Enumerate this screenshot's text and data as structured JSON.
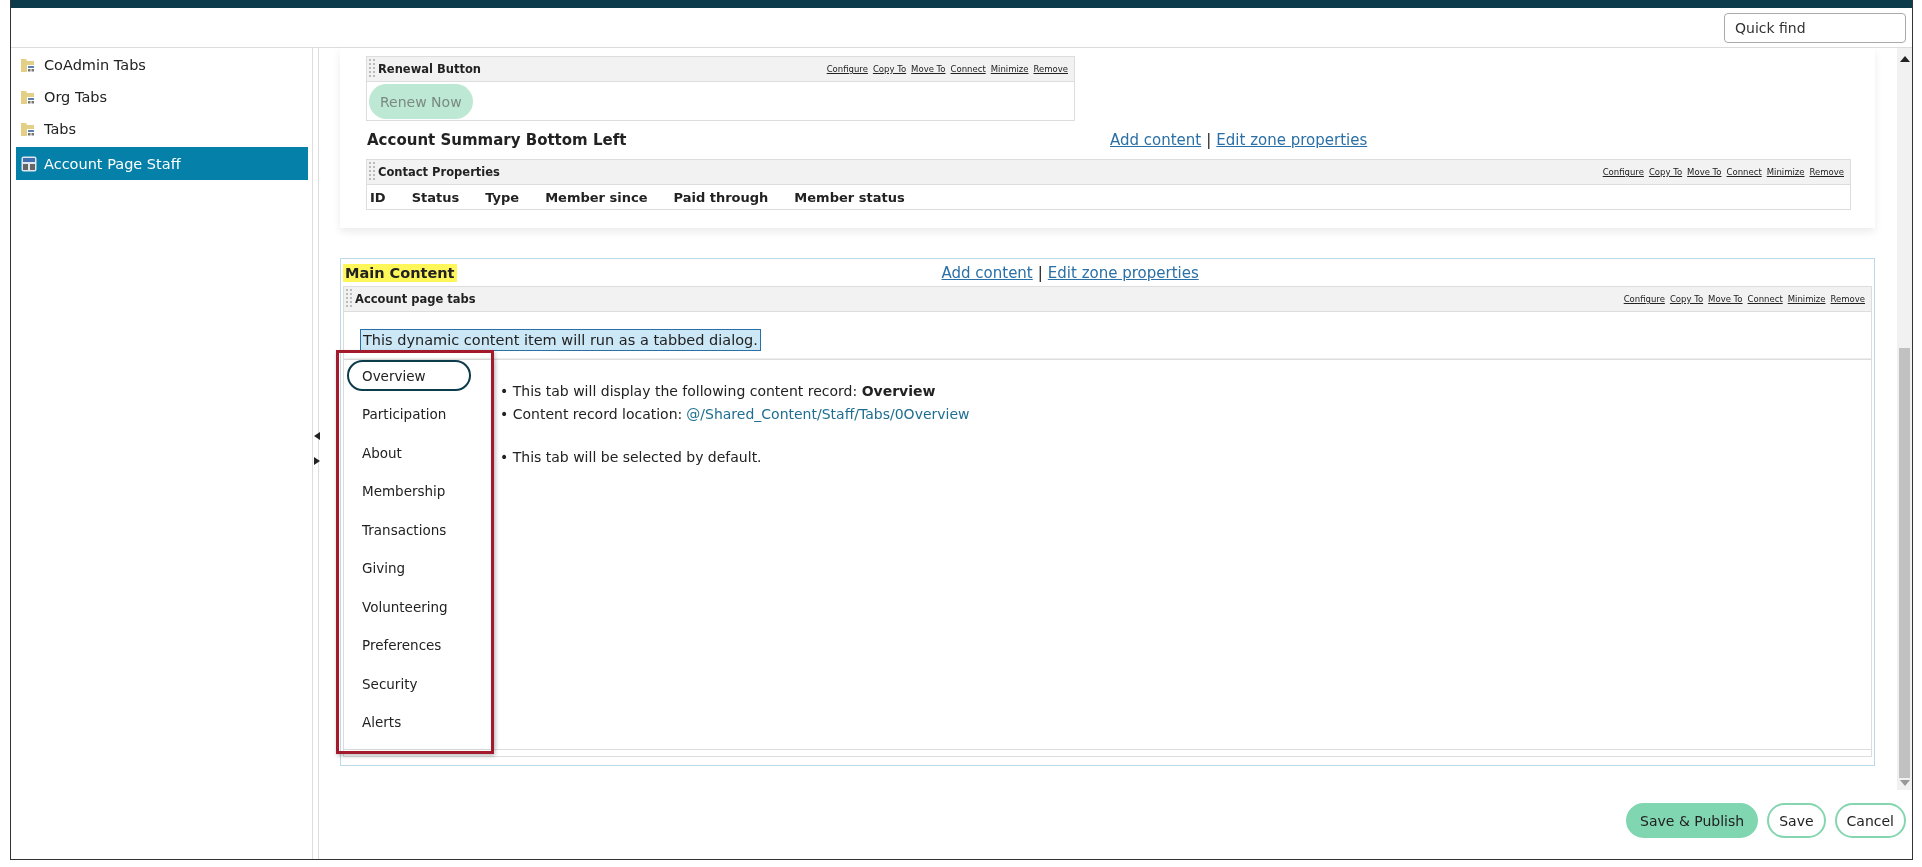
{
  "quick_find": {
    "placeholder": "Quick find"
  },
  "sidebar": {
    "items": [
      {
        "label": "CoAdmin Tabs",
        "kind": "folder",
        "selected": false
      },
      {
        "label": "Org Tabs",
        "kind": "folder",
        "selected": false
      },
      {
        "label": "Tabs",
        "kind": "folder",
        "selected": false
      },
      {
        "label": "Account Page Staff",
        "kind": "page",
        "selected": true
      }
    ]
  },
  "top_zone": {
    "renewal_part": {
      "title": "Renewal Button",
      "actions": [
        "Configure",
        "Copy To",
        "Move To",
        "Connect",
        "Minimize",
        "Remove"
      ],
      "button": "Renew Now"
    },
    "title": "Account Summary Bottom Left",
    "links": [
      "Add content",
      "Edit zone properties"
    ],
    "link_separator": "|",
    "contact_part": {
      "title": "Contact Properties",
      "actions": [
        "Configure",
        "Copy To",
        "Move To",
        "Connect",
        "Minimize",
        "Remove"
      ],
      "columns": [
        "ID",
        "Status",
        "Type",
        "Member since",
        "Paid through",
        "Member status"
      ]
    }
  },
  "main_zone": {
    "title": "Main Content",
    "links": [
      "Add content",
      "Edit zone properties"
    ],
    "link_separator": "|",
    "part": {
      "title": "Account page tabs",
      "actions": [
        "Configure",
        "Copy To",
        "Move To",
        "Connect",
        "Minimize",
        "Remove"
      ],
      "notice": "This dynamic content item will run as a tabbed dialog.",
      "tabs_highlighted": true,
      "tabs": [
        {
          "label": "Overview",
          "selected": true
        },
        {
          "label": "Participation",
          "selected": false
        },
        {
          "label": "About",
          "selected": false
        },
        {
          "label": "Membership",
          "selected": false
        },
        {
          "label": "Transactions",
          "selected": false
        },
        {
          "label": "Giving",
          "selected": false
        },
        {
          "label": "Volunteering",
          "selected": false
        },
        {
          "label": "Preferences",
          "selected": false
        },
        {
          "label": "Security",
          "selected": false
        },
        {
          "label": "Alerts",
          "selected": false
        }
      ],
      "details": [
        {
          "kind": "text",
          "text": "• This tab will display the following content record: **Overview**"
        },
        {
          "kind": "link",
          "text": "• Content record location:",
          "link": "@/Shared_Content/Staff/Tabs/0Overview"
        },
        {
          "kind": "gap"
        },
        {
          "kind": "text",
          "text": "• This tab will be selected by default."
        }
      ]
    }
  },
  "buttons": [
    {
      "label": "Save & Publish",
      "kind": "primary"
    },
    {
      "label": "Save",
      "kind": "secondary"
    },
    {
      "label": "Cancel",
      "kind": "secondary"
    }
  ]
}
